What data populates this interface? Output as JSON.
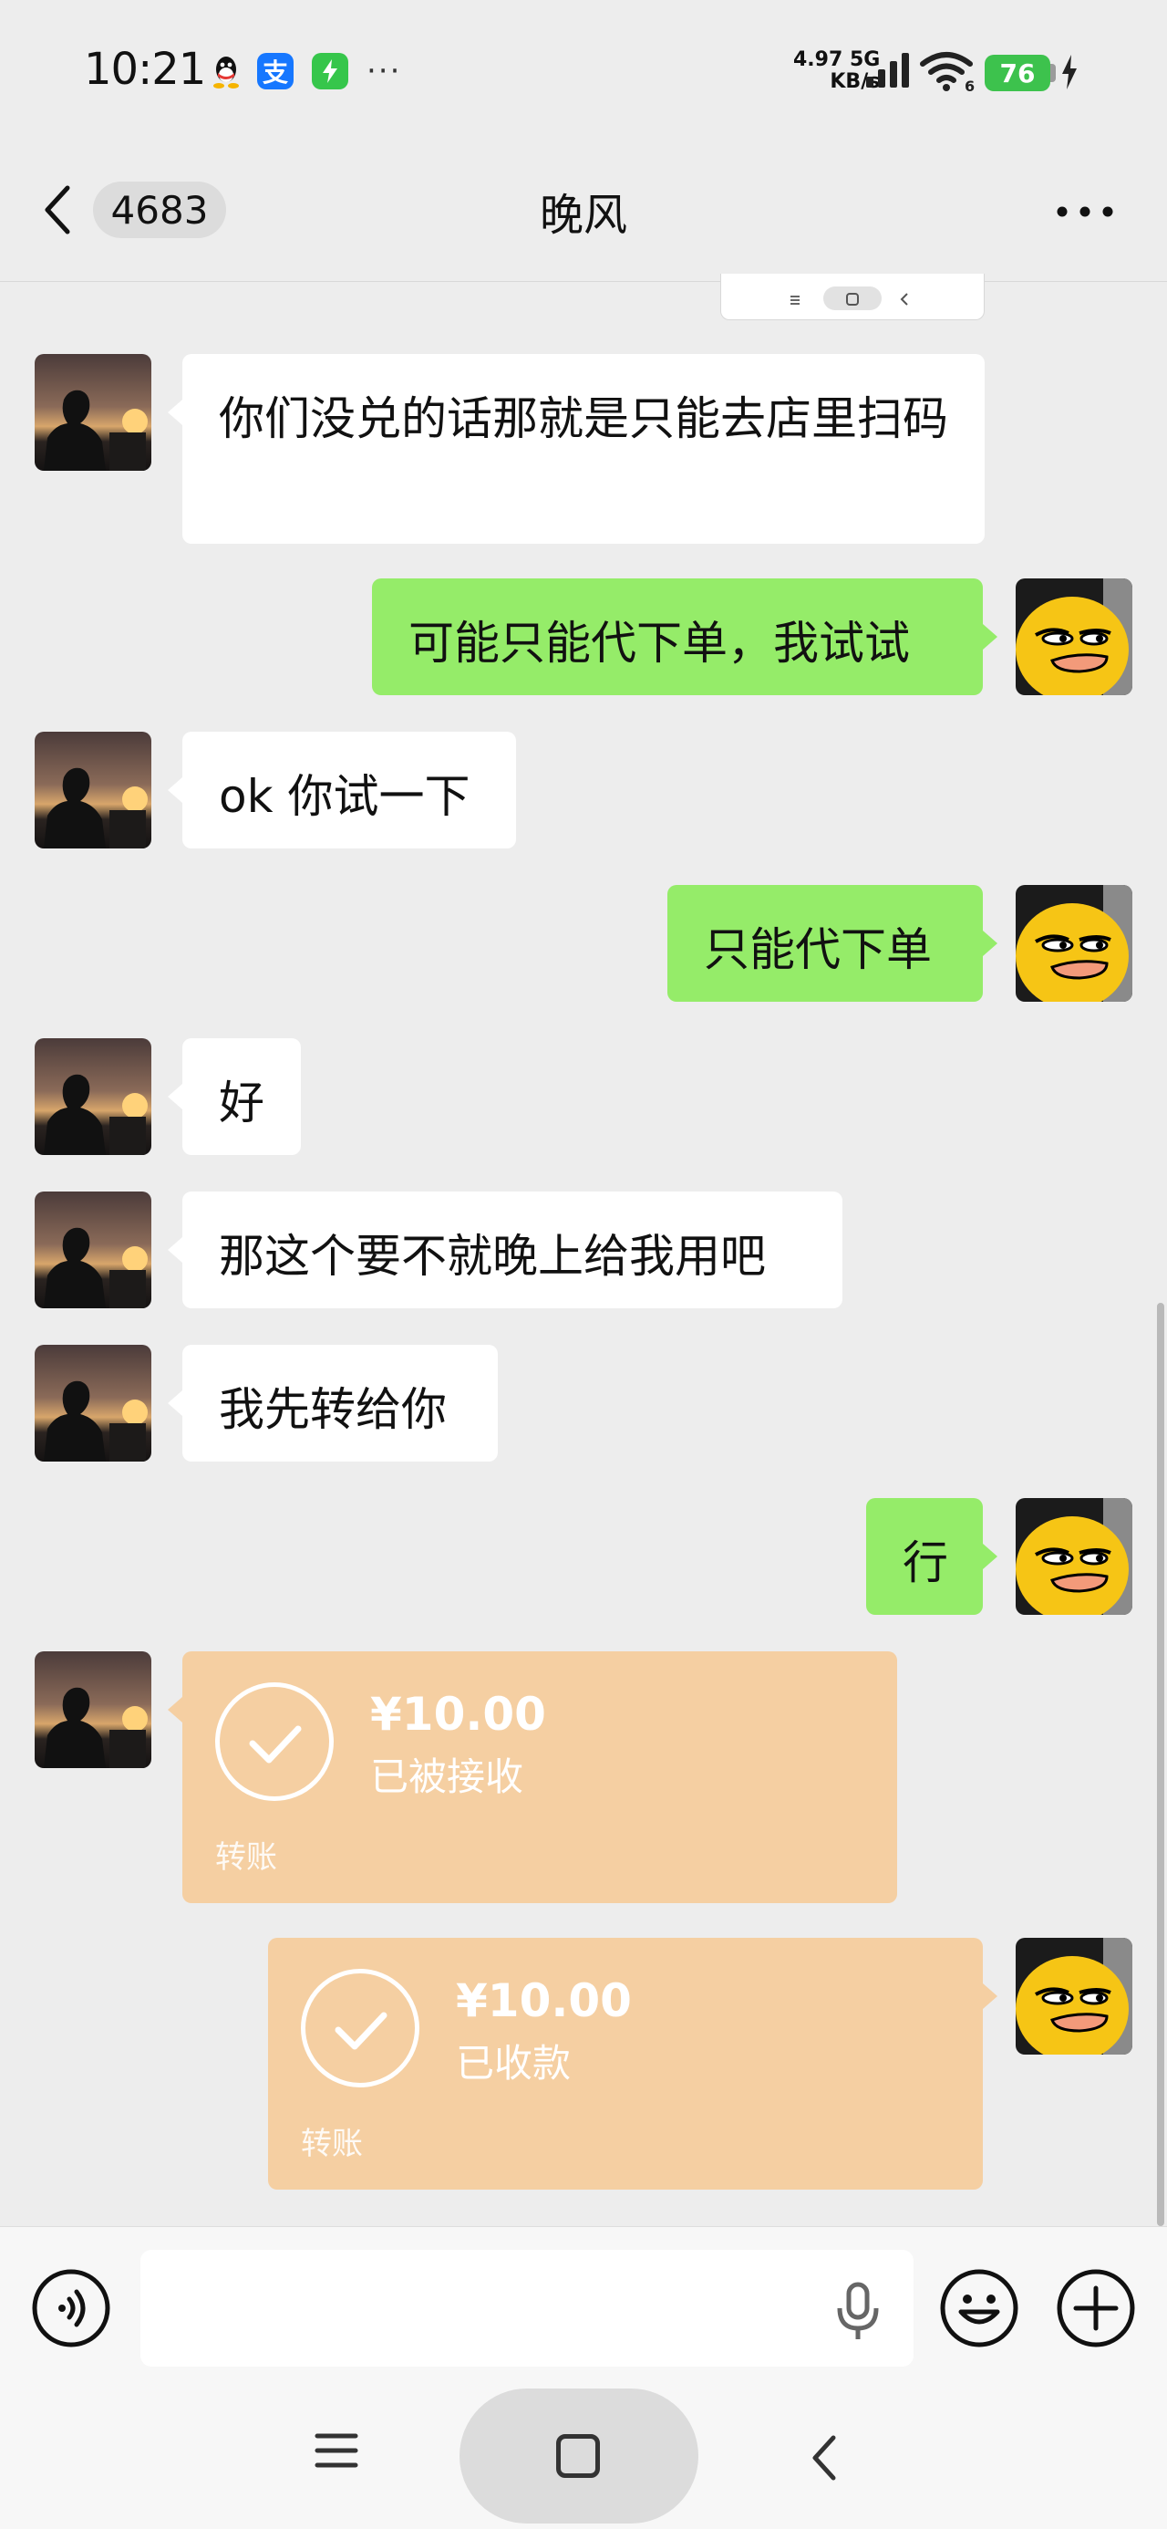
{
  "status_bar": {
    "time": "10:21",
    "app_icons": [
      "qq-icon",
      "alipay-icon",
      "bolt-app-icon"
    ],
    "alipay_glyph": "支",
    "more": "···",
    "net_speed_value": "4.97",
    "net_type": "5G",
    "net_speed_unit": "KB/s",
    "wifi_badge": "6",
    "battery": "76"
  },
  "nav": {
    "unread_count": "4683",
    "title": "晚风"
  },
  "messages": [
    {
      "side": "in",
      "type": "text",
      "text": "你们没兑的话那就是只能去店里扫码"
    },
    {
      "side": "out",
      "type": "text",
      "text": "可能只能代下单，我试试"
    },
    {
      "side": "in",
      "type": "text",
      "text": "ok 你试一下"
    },
    {
      "side": "out",
      "type": "text",
      "text": "只能代下单"
    },
    {
      "side": "in",
      "type": "text",
      "text": "好"
    },
    {
      "side": "in",
      "type": "text",
      "text": "那这个要不就晚上给我用吧"
    },
    {
      "side": "in",
      "type": "text",
      "text": "我先转给你"
    },
    {
      "side": "out",
      "type": "text",
      "text": "行"
    },
    {
      "side": "in",
      "type": "transfer",
      "amount": "¥10.00",
      "status": "已被接收",
      "label": "转账"
    },
    {
      "side": "out",
      "type": "transfer",
      "amount": "¥10.00",
      "status": "已收款",
      "label": "转账"
    }
  ],
  "colors": {
    "background": "#ededed",
    "bubble_out": "#95ec69",
    "bubble_in": "#ffffff",
    "transfer": "#f5cfa2",
    "battery": "#3dc24d"
  }
}
